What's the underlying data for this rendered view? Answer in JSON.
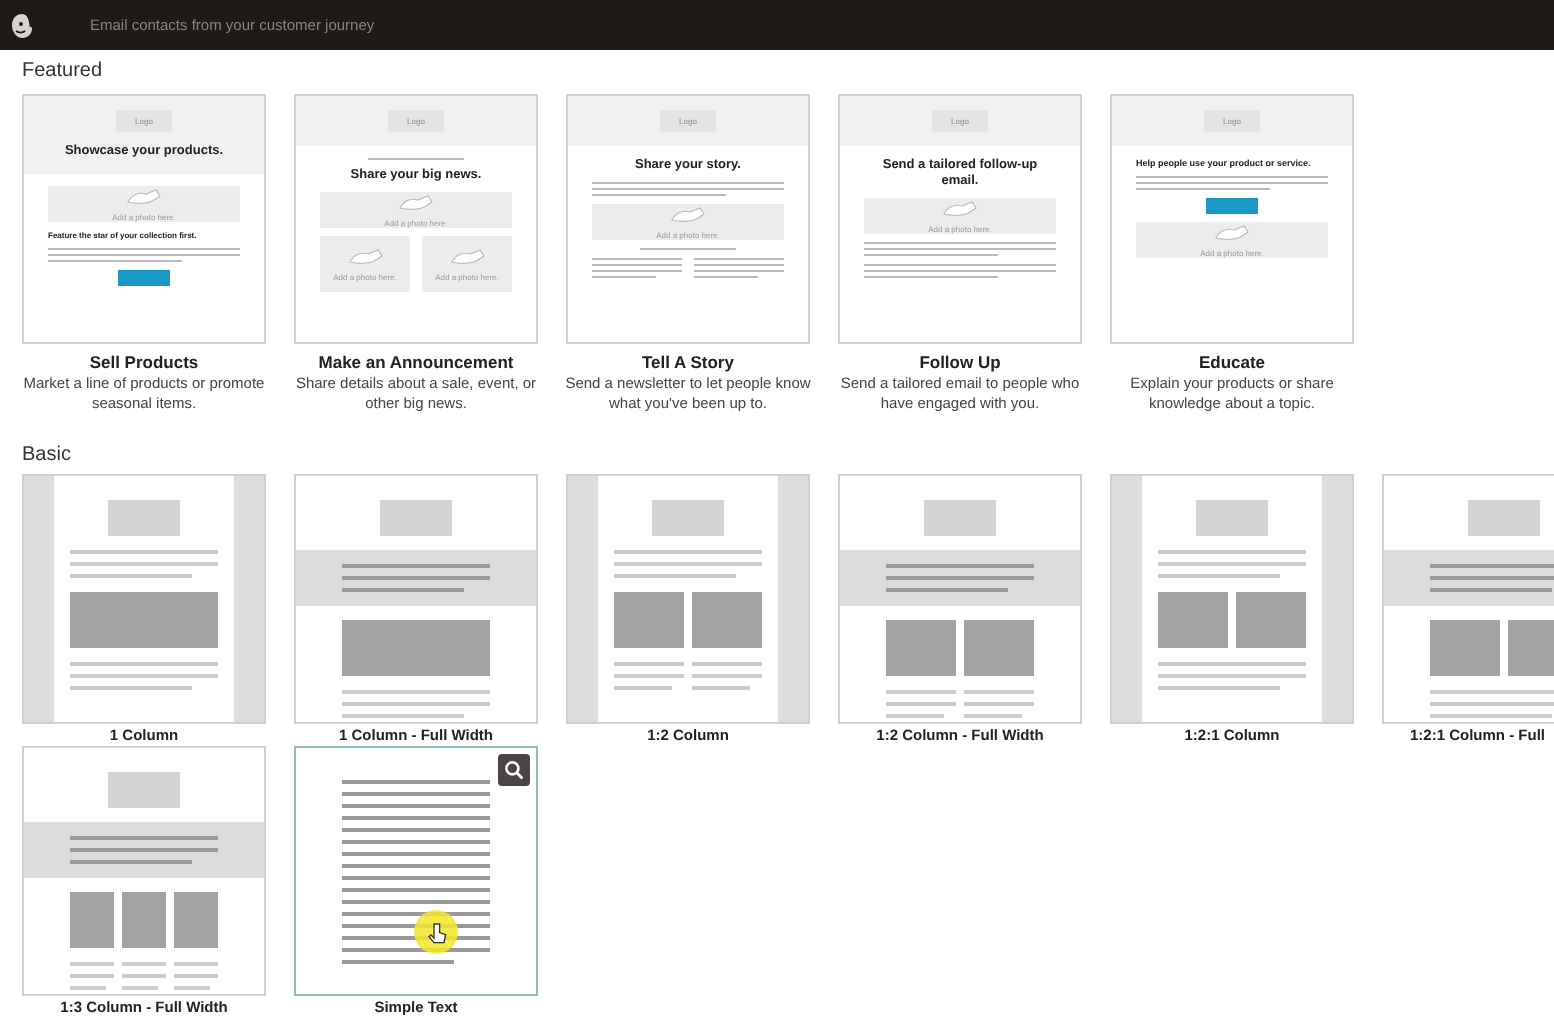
{
  "header": {
    "title": "Email contacts from your customer journey"
  },
  "featured": {
    "heading": "Featured",
    "templates": [
      {
        "name": "Sell Products",
        "description": "Market a line of products or promote seasonal items.",
        "preview": {
          "band": [
            {
              "kind": "logo",
              "text": "Logo"
            },
            {
              "kind": "heading",
              "text": "Showcase your products."
            }
          ],
          "body": [
            {
              "kind": "photo",
              "caption": "Add a photo here."
            },
            {
              "kind": "subheading",
              "text": "Feature the star of your collection first."
            },
            {
              "kind": "lines"
            },
            {
              "kind": "button"
            }
          ]
        }
      },
      {
        "name": "Make an Announcement",
        "description": "Share details about a sale, event, or other big news.",
        "preview": {
          "band": [
            {
              "kind": "logo",
              "text": "Logo"
            }
          ],
          "body": [
            {
              "kind": "small-line"
            },
            {
              "kind": "heading",
              "text": "Share your big news."
            },
            {
              "kind": "photo",
              "caption": "Add a photo here."
            },
            {
              "kind": "photo-pair",
              "captions": [
                "Add a photo here.",
                "Add a photo here."
              ]
            }
          ]
        }
      },
      {
        "name": "Tell A Story",
        "description": "Send a newsletter to let people know what you've been up to.",
        "preview": {
          "band": [
            {
              "kind": "logo",
              "text": "Logo"
            }
          ],
          "body": [
            {
              "kind": "heading",
              "text": "Share your story."
            },
            {
              "kind": "lines"
            },
            {
              "kind": "photo",
              "caption": "Add a photo here."
            },
            {
              "kind": "small-line"
            },
            {
              "kind": "two-col-lines"
            }
          ]
        }
      },
      {
        "name": "Follow Up",
        "description": "Send a tailored email to people who have engaged with you.",
        "preview": {
          "band": [
            {
              "kind": "logo",
              "text": "Logo"
            }
          ],
          "body": [
            {
              "kind": "heading",
              "text": "Send a tailored follow-up email."
            },
            {
              "kind": "photo",
              "caption": "Add a photo here."
            },
            {
              "kind": "lines"
            },
            {
              "kind": "lines"
            }
          ]
        }
      },
      {
        "name": "Educate",
        "description": "Explain your products or share knowledge about a topic.",
        "preview": {
          "band": [
            {
              "kind": "logo",
              "text": "Logo"
            }
          ],
          "body": [
            {
              "kind": "small-heading",
              "text": "Help people use your product or service."
            },
            {
              "kind": "lines"
            },
            {
              "kind": "button"
            },
            {
              "kind": "photo",
              "caption": "Add a photo here."
            }
          ]
        }
      }
    ]
  },
  "basic": {
    "heading": "Basic",
    "templates": [
      {
        "name": "1 Column",
        "kind": "single",
        "hovered": false
      },
      {
        "name": "1 Column - Full Width",
        "kind": "singlewide",
        "hovered": false
      },
      {
        "name": "1:2 Column",
        "kind": "split",
        "hovered": false
      },
      {
        "name": "1:2 Column - Full Width",
        "kind": "splitwide",
        "hovered": false
      },
      {
        "name": "1:2:1 Column",
        "kind": "mixed",
        "hovered": false
      },
      {
        "name": "1:2:1 Column - Full",
        "kind": "mixedwide",
        "hovered": false
      },
      {
        "name": "1:3 Column - Full Width",
        "kind": "triplewide",
        "hovered": false
      },
      {
        "name": "Simple Text",
        "kind": "plaintext",
        "hovered": true
      }
    ]
  }
}
